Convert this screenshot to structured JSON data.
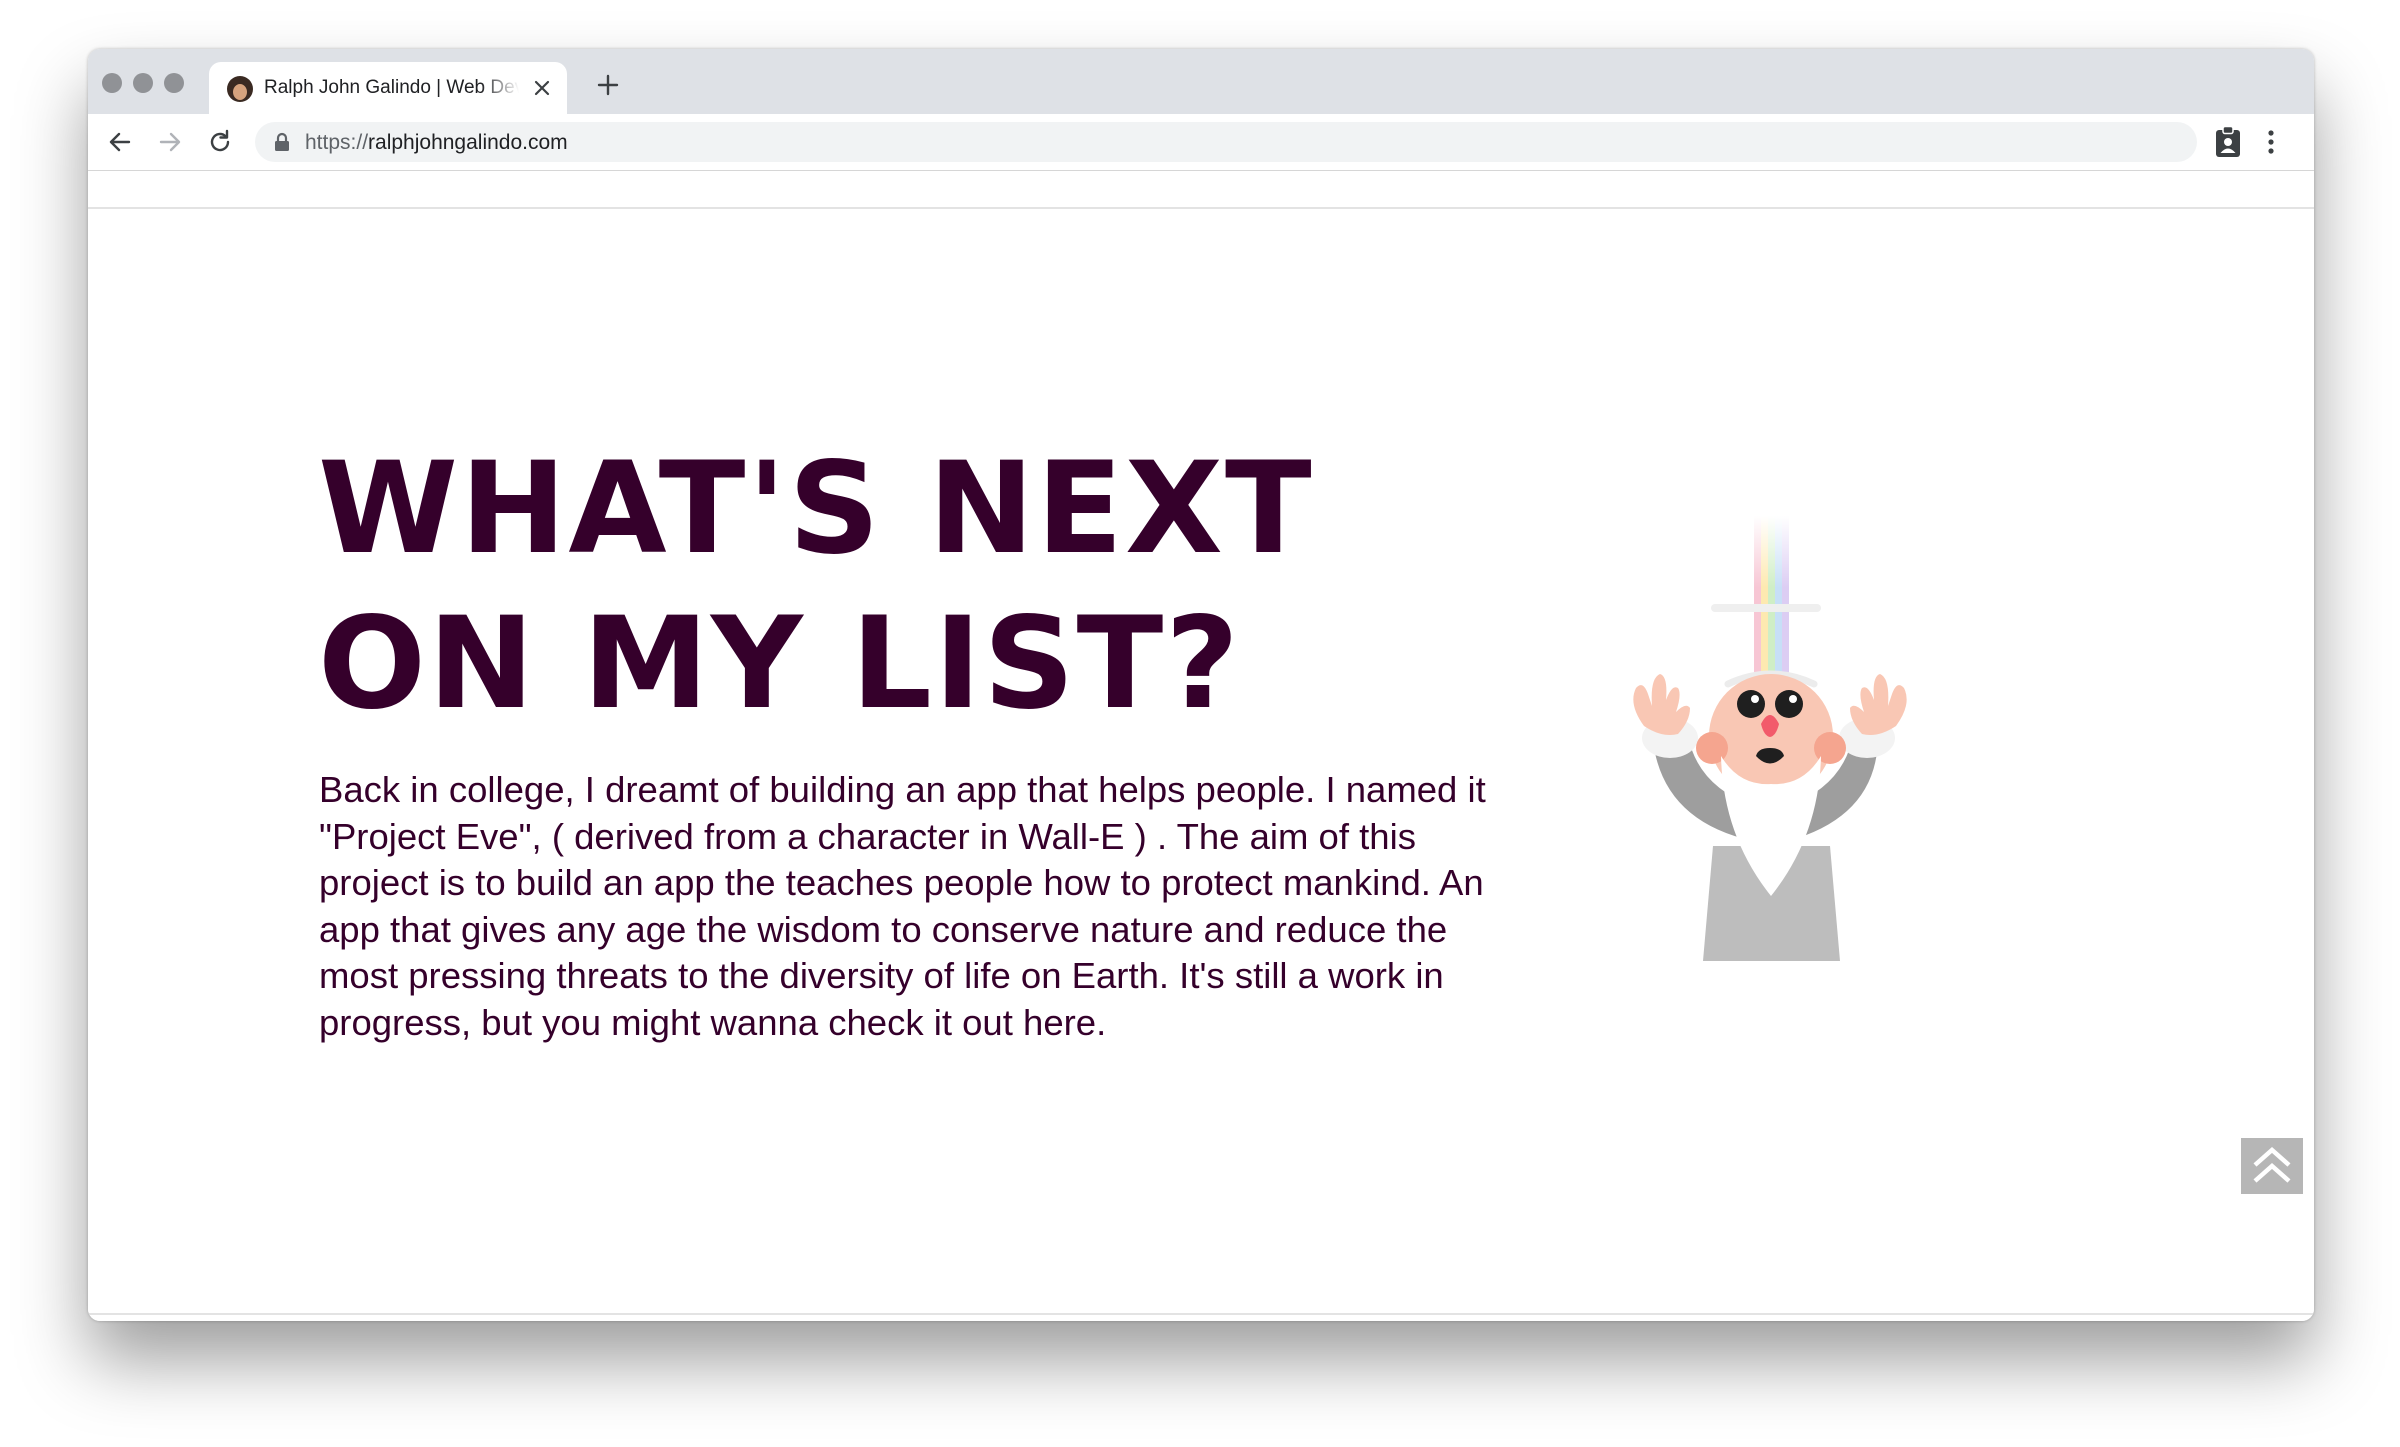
{
  "browser": {
    "tab": {
      "title": "Ralph John Galindo | Web Developer"
    },
    "url": {
      "scheme": "https://",
      "host": "ralphjohngalindo.com"
    }
  },
  "page": {
    "headline": {
      "line1": "WHAT'S NEXT",
      "line2": "ON MY LIST?"
    },
    "bio": {
      "text": "Back in college, I dreamt of building an app that helps people. I named it \"Project Eve\", ( derived from a character in Wall-E ) . The aim of this project is to build an app the teaches people how to protect mankind. An app that gives any age the wisdom to conserve nature and reduce the most pressing threats to the diversity of life on Earth. It's still a work in progress, but you might wanna check it out ",
      "link": "here",
      "end": "."
    },
    "illustration": "wizard-character-with-rainbow",
    "scroll_top_icon": "double-chevron-up-icon"
  },
  "colors": {
    "headline": "#35002b",
    "tabbar": "#dee1e6",
    "scroll_button": "#b6b6b6"
  }
}
